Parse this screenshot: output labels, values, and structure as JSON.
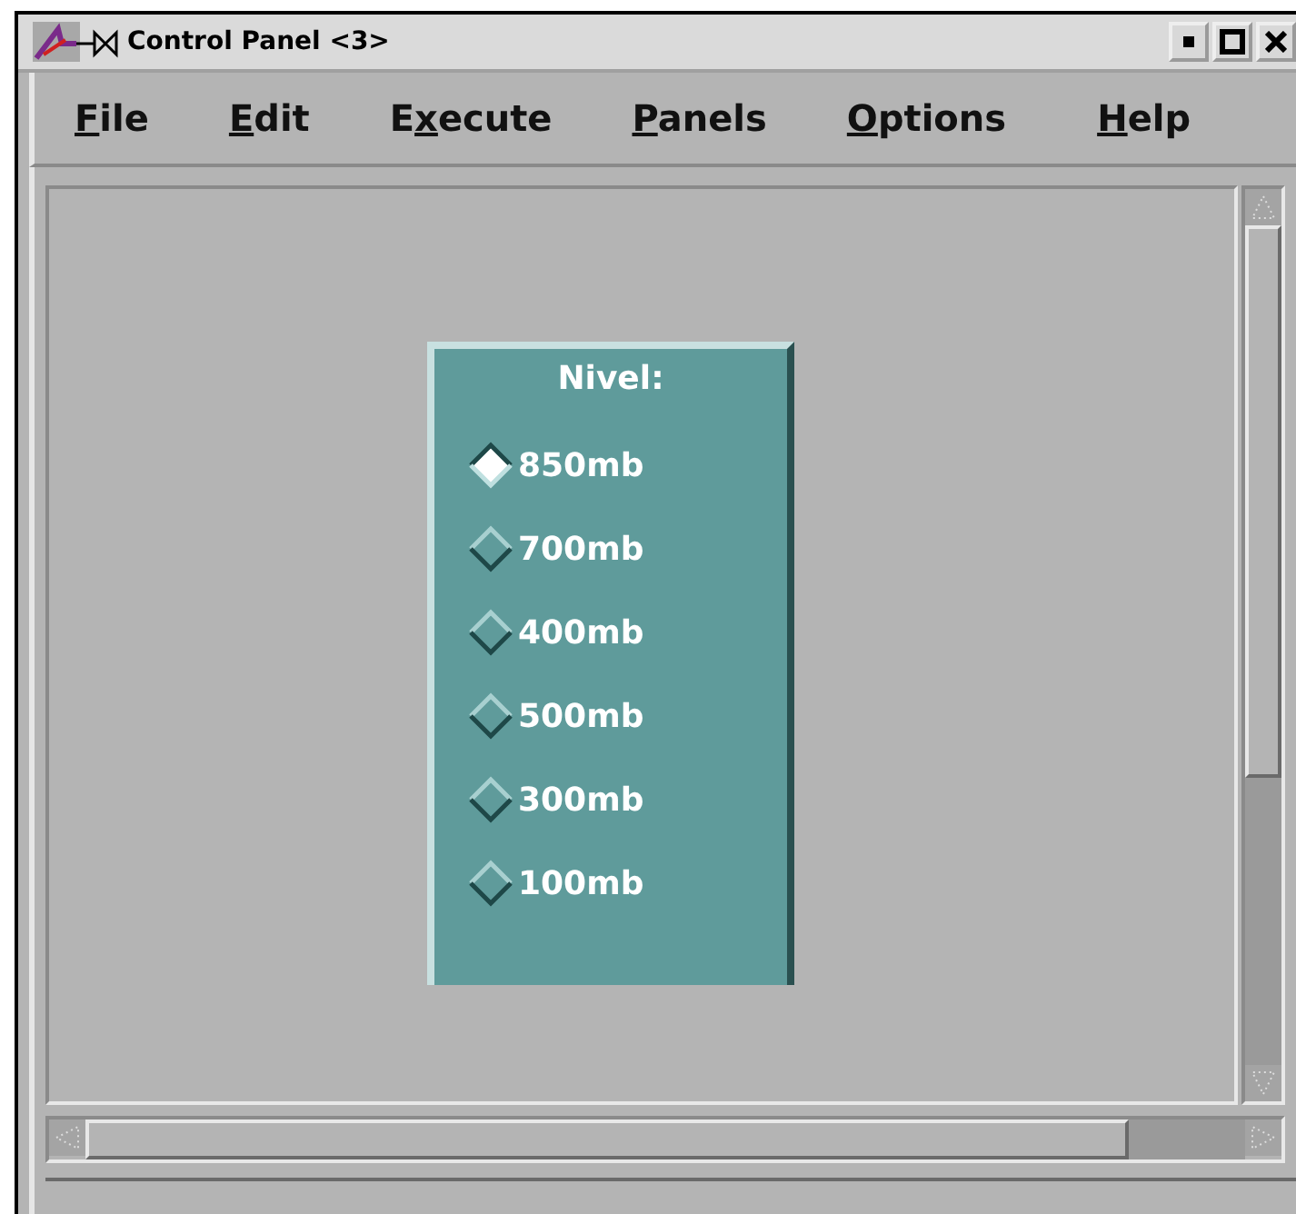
{
  "window": {
    "title": "Control Panel <3>"
  },
  "menu": [
    {
      "key": "F",
      "after": "ile"
    },
    {
      "key": "E",
      "after": "dit"
    },
    {
      "before": "E",
      "key": "x",
      "after": "ecute"
    },
    {
      "key": "P",
      "after": "anels"
    },
    {
      "key": "O",
      "after": "ptions"
    },
    {
      "key": "H",
      "after": "elp"
    }
  ],
  "panel": {
    "title": "Nivel:",
    "options": [
      {
        "label": "850mb",
        "selected": true
      },
      {
        "label": "700mb",
        "selected": false
      },
      {
        "label": "400mb",
        "selected": false
      },
      {
        "label": "500mb",
        "selected": false
      },
      {
        "label": "300mb",
        "selected": false
      },
      {
        "label": "100mb",
        "selected": false
      }
    ]
  }
}
